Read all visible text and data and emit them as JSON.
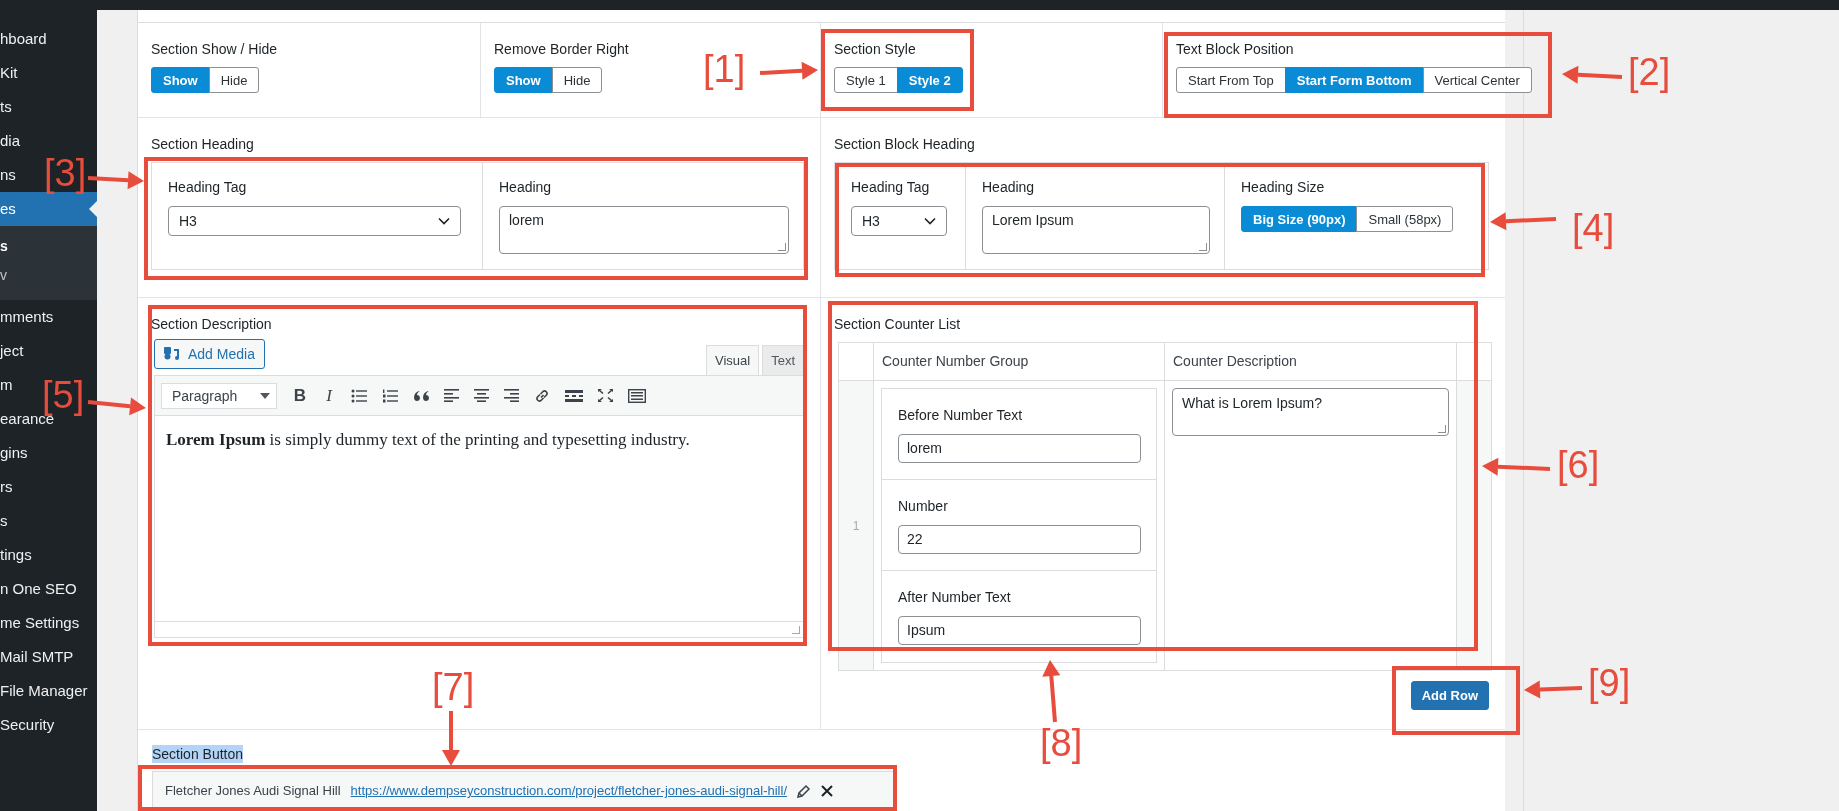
{
  "admin_menu": {
    "items": [
      {
        "label": "hboard",
        "selected": false
      },
      {
        "label": "Kit",
        "selected": false
      },
      {
        "label": "ts",
        "selected": false
      },
      {
        "label": "dia",
        "selected": false
      },
      {
        "label": "ns",
        "selected": false
      },
      {
        "label": "es",
        "selected": true,
        "children": [
          {
            "label": "s",
            "selected": true
          },
          {
            "label": "v",
            "selected": false
          }
        ]
      },
      {
        "label": "mments",
        "selected": false
      },
      {
        "label": "ject",
        "selected": false
      },
      {
        "label": "m",
        "selected": false
      },
      {
        "label": "earance",
        "selected": false
      },
      {
        "label": "gins",
        "selected": false
      },
      {
        "label": "rs",
        "selected": false
      },
      {
        "label": "s",
        "selected": false
      },
      {
        "label": "tings",
        "selected": false
      },
      {
        "label": "n One SEO",
        "selected": false
      },
      {
        "label": "me Settings",
        "selected": false
      },
      {
        "label": "Mail SMTP",
        "selected": false
      },
      {
        "label": "File Manager",
        "selected": false
      },
      {
        "label": "Security",
        "selected": false
      }
    ]
  },
  "settings": {
    "toggles": [
      {
        "label": "Section Show / Hide",
        "options": [
          {
            "label": "Show",
            "selected": true
          },
          {
            "label": "Hide",
            "selected": false
          }
        ]
      },
      {
        "label": "Remove Border Right",
        "options": [
          {
            "label": "Show",
            "selected": true
          },
          {
            "label": "Hide",
            "selected": false
          }
        ]
      },
      {
        "label": "Section Style",
        "options": [
          {
            "label": "Style 1",
            "selected": false
          },
          {
            "label": "Style 2",
            "selected": true
          }
        ]
      },
      {
        "label": "Text Block Position",
        "options": [
          {
            "label": "Start From Top",
            "selected": false
          },
          {
            "label": "Start Form Bottom",
            "selected": true
          },
          {
            "label": "Vertical Center",
            "selected": false
          }
        ]
      }
    ],
    "section_heading": {
      "label": "Section Heading",
      "fields": [
        {
          "kind": "select",
          "label": "Heading Tag",
          "value": "H3"
        },
        {
          "kind": "textarea",
          "label": "Heading",
          "value": "lorem"
        }
      ]
    },
    "section_block_heading": {
      "label": "Section Block Heading",
      "fields": [
        {
          "kind": "select",
          "label": "Heading Tag",
          "value": "H3"
        },
        {
          "kind": "textarea",
          "label": "Heading",
          "value": "Lorem Ipsum"
        },
        {
          "kind": "toggle",
          "label": "Heading Size",
          "options": [
            {
              "label": "Big Size (90px)",
              "selected": true
            },
            {
              "label": "Small (58px)",
              "selected": false
            }
          ]
        }
      ]
    },
    "section_description": {
      "label": "Section Description",
      "add_media": "Add Media",
      "tabs": [
        {
          "label": "Visual",
          "selected": true
        },
        {
          "label": "Text",
          "selected": false
        }
      ],
      "format": "Paragraph",
      "toolbar": [
        {
          "kind": "glyph",
          "label": "B"
        },
        {
          "kind": "glyph",
          "label": "I"
        },
        {
          "kind": "bullet-list"
        },
        {
          "kind": "numbered-list"
        },
        {
          "kind": "quote"
        },
        {
          "kind": "align-left"
        },
        {
          "kind": "align-center"
        },
        {
          "kind": "align-right"
        },
        {
          "kind": "link"
        },
        {
          "kind": "read-more"
        },
        {
          "kind": "fullscreen"
        },
        {
          "kind": "keyboard"
        }
      ],
      "content": "**Lorem Ipsum** is simply dummy text of the printing and typesetting industry."
    },
    "section_counter_list": {
      "label": "Section Counter List",
      "columns": [
        "Counter Number Group",
        "Counter Description"
      ],
      "rows": [
        {
          "index": "1",
          "fields": [
            {
              "label": "Before Number Text",
              "value": "lorem"
            },
            {
              "label": "Number",
              "value": "22"
            },
            {
              "label": "After Number Text",
              "value": "Ipsum"
            }
          ],
          "description": "What is Lorem Ipsum?"
        }
      ],
      "add_button": "Add Row"
    },
    "section_button": {
      "label": "Section Button",
      "link_title": "Fletcher Jones Audi Signal Hill",
      "url": "https://www.dempseyconstruction.com/project/fletcher-jones-audi-signal-hill/"
    }
  },
  "annotations": [
    {
      "label": "[1]"
    },
    {
      "label": "[2]"
    },
    {
      "label": "[3]"
    },
    {
      "label": "[4]"
    },
    {
      "label": "[5]"
    },
    {
      "label": "[6]"
    },
    {
      "label": "[7]"
    },
    {
      "label": "[8]"
    },
    {
      "label": "[9]"
    }
  ]
}
